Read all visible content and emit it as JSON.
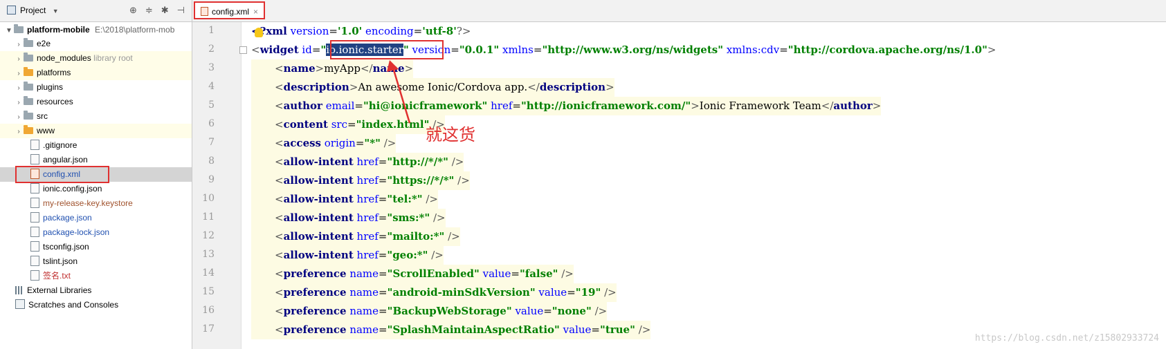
{
  "project_panel": {
    "title": "Project",
    "root": {
      "name": "platform-mobile",
      "path": "E:\\2018\\platform-mob"
    },
    "items": [
      {
        "label": "e2e"
      },
      {
        "label": "node_modules",
        "note": "library root"
      },
      {
        "label": "platforms"
      },
      {
        "label": "plugins"
      },
      {
        "label": "resources"
      },
      {
        "label": "src"
      },
      {
        "label": "www"
      },
      {
        "label": ".gitignore"
      },
      {
        "label": "angular.json"
      },
      {
        "label": "config.xml"
      },
      {
        "label": "ionic.config.json"
      },
      {
        "label": "my-release-key.keystore"
      },
      {
        "label": "package.json"
      },
      {
        "label": "package-lock.json"
      },
      {
        "label": "tsconfig.json"
      },
      {
        "label": "tslint.json"
      },
      {
        "label": "签名.txt"
      }
    ],
    "external_libraries": "External Libraries",
    "scratches": "Scratches and Consoles"
  },
  "editor": {
    "tab_label": "config.xml",
    "line_numbers": [
      "1",
      "2",
      "3",
      "4",
      "5",
      "6",
      "7",
      "8",
      "9",
      "10",
      "11",
      "12",
      "13",
      "14",
      "15",
      "16",
      "17"
    ],
    "code": {
      "l1_decl": "<?xml",
      "l1_version_attr": "version",
      "l1_version_val": "'1.0'",
      "l1_encoding_attr": "encoding",
      "l1_encoding_val": "'utf-8'",
      "l1_end": "?>",
      "l2_tag": "widget",
      "l2_id_attr": "id",
      "l2_id_val": "io.ionic.starter",
      "l2_version_attr": "version",
      "l2_version_val": "\"0.0.1\"",
      "l2_xmlns_attr": "xmlns",
      "l2_xmlns_val": "\"http://www.w3.org/ns/widgets\"",
      "l2_xmlnscdv_attr": "xmlns:cdv",
      "l2_xmlnscdv_val": "\"http://cordova.apache.org/ns/1.0\"",
      "l3_tag": "name",
      "l3_text": "myApp",
      "l4_tag": "description",
      "l4_text": "An awesome Ionic/Cordova app.",
      "l5_tag": "author",
      "l5_email_attr": "email",
      "l5_email_val": "\"hi@ionicframework\"",
      "l5_href_attr": "href",
      "l5_href_val": "\"http://ionicframework.com/\"",
      "l5_text": "Ionic Framework Team",
      "l6_tag": "content",
      "l6_src_attr": "src",
      "l6_src_val": "\"index.html\"",
      "l7_tag": "access",
      "l7_origin_attr": "origin",
      "l7_origin_val": "\"*\"",
      "allow_tag": "allow-intent",
      "href_attr": "href",
      "l8_val": "\"http://*/*\"",
      "l9_val": "\"https://*/*\"",
      "l10_val": "\"tel:*\"",
      "l11_val": "\"sms:*\"",
      "l12_val": "\"mailto:*\"",
      "l13_val": "\"geo:*\"",
      "pref_tag": "preference",
      "name_attr": "name",
      "value_attr": "value",
      "l14_name": "\"ScrollEnabled\"",
      "l14_value": "\"false\"",
      "l15_name": "\"android-minSdkVersion\"",
      "l15_value": "\"19\"",
      "l16_name": "\"BackupWebStorage\"",
      "l16_value": "\"none\"",
      "l17_name": "\"SplashMaintainAspectRatio\"",
      "l17_value": "\"true\""
    },
    "annotation": "就这货",
    "watermark": "https://blog.csdn.net/z15802933724"
  },
  "colors": {
    "accent_red": "#e03030",
    "selection": "#214283"
  }
}
